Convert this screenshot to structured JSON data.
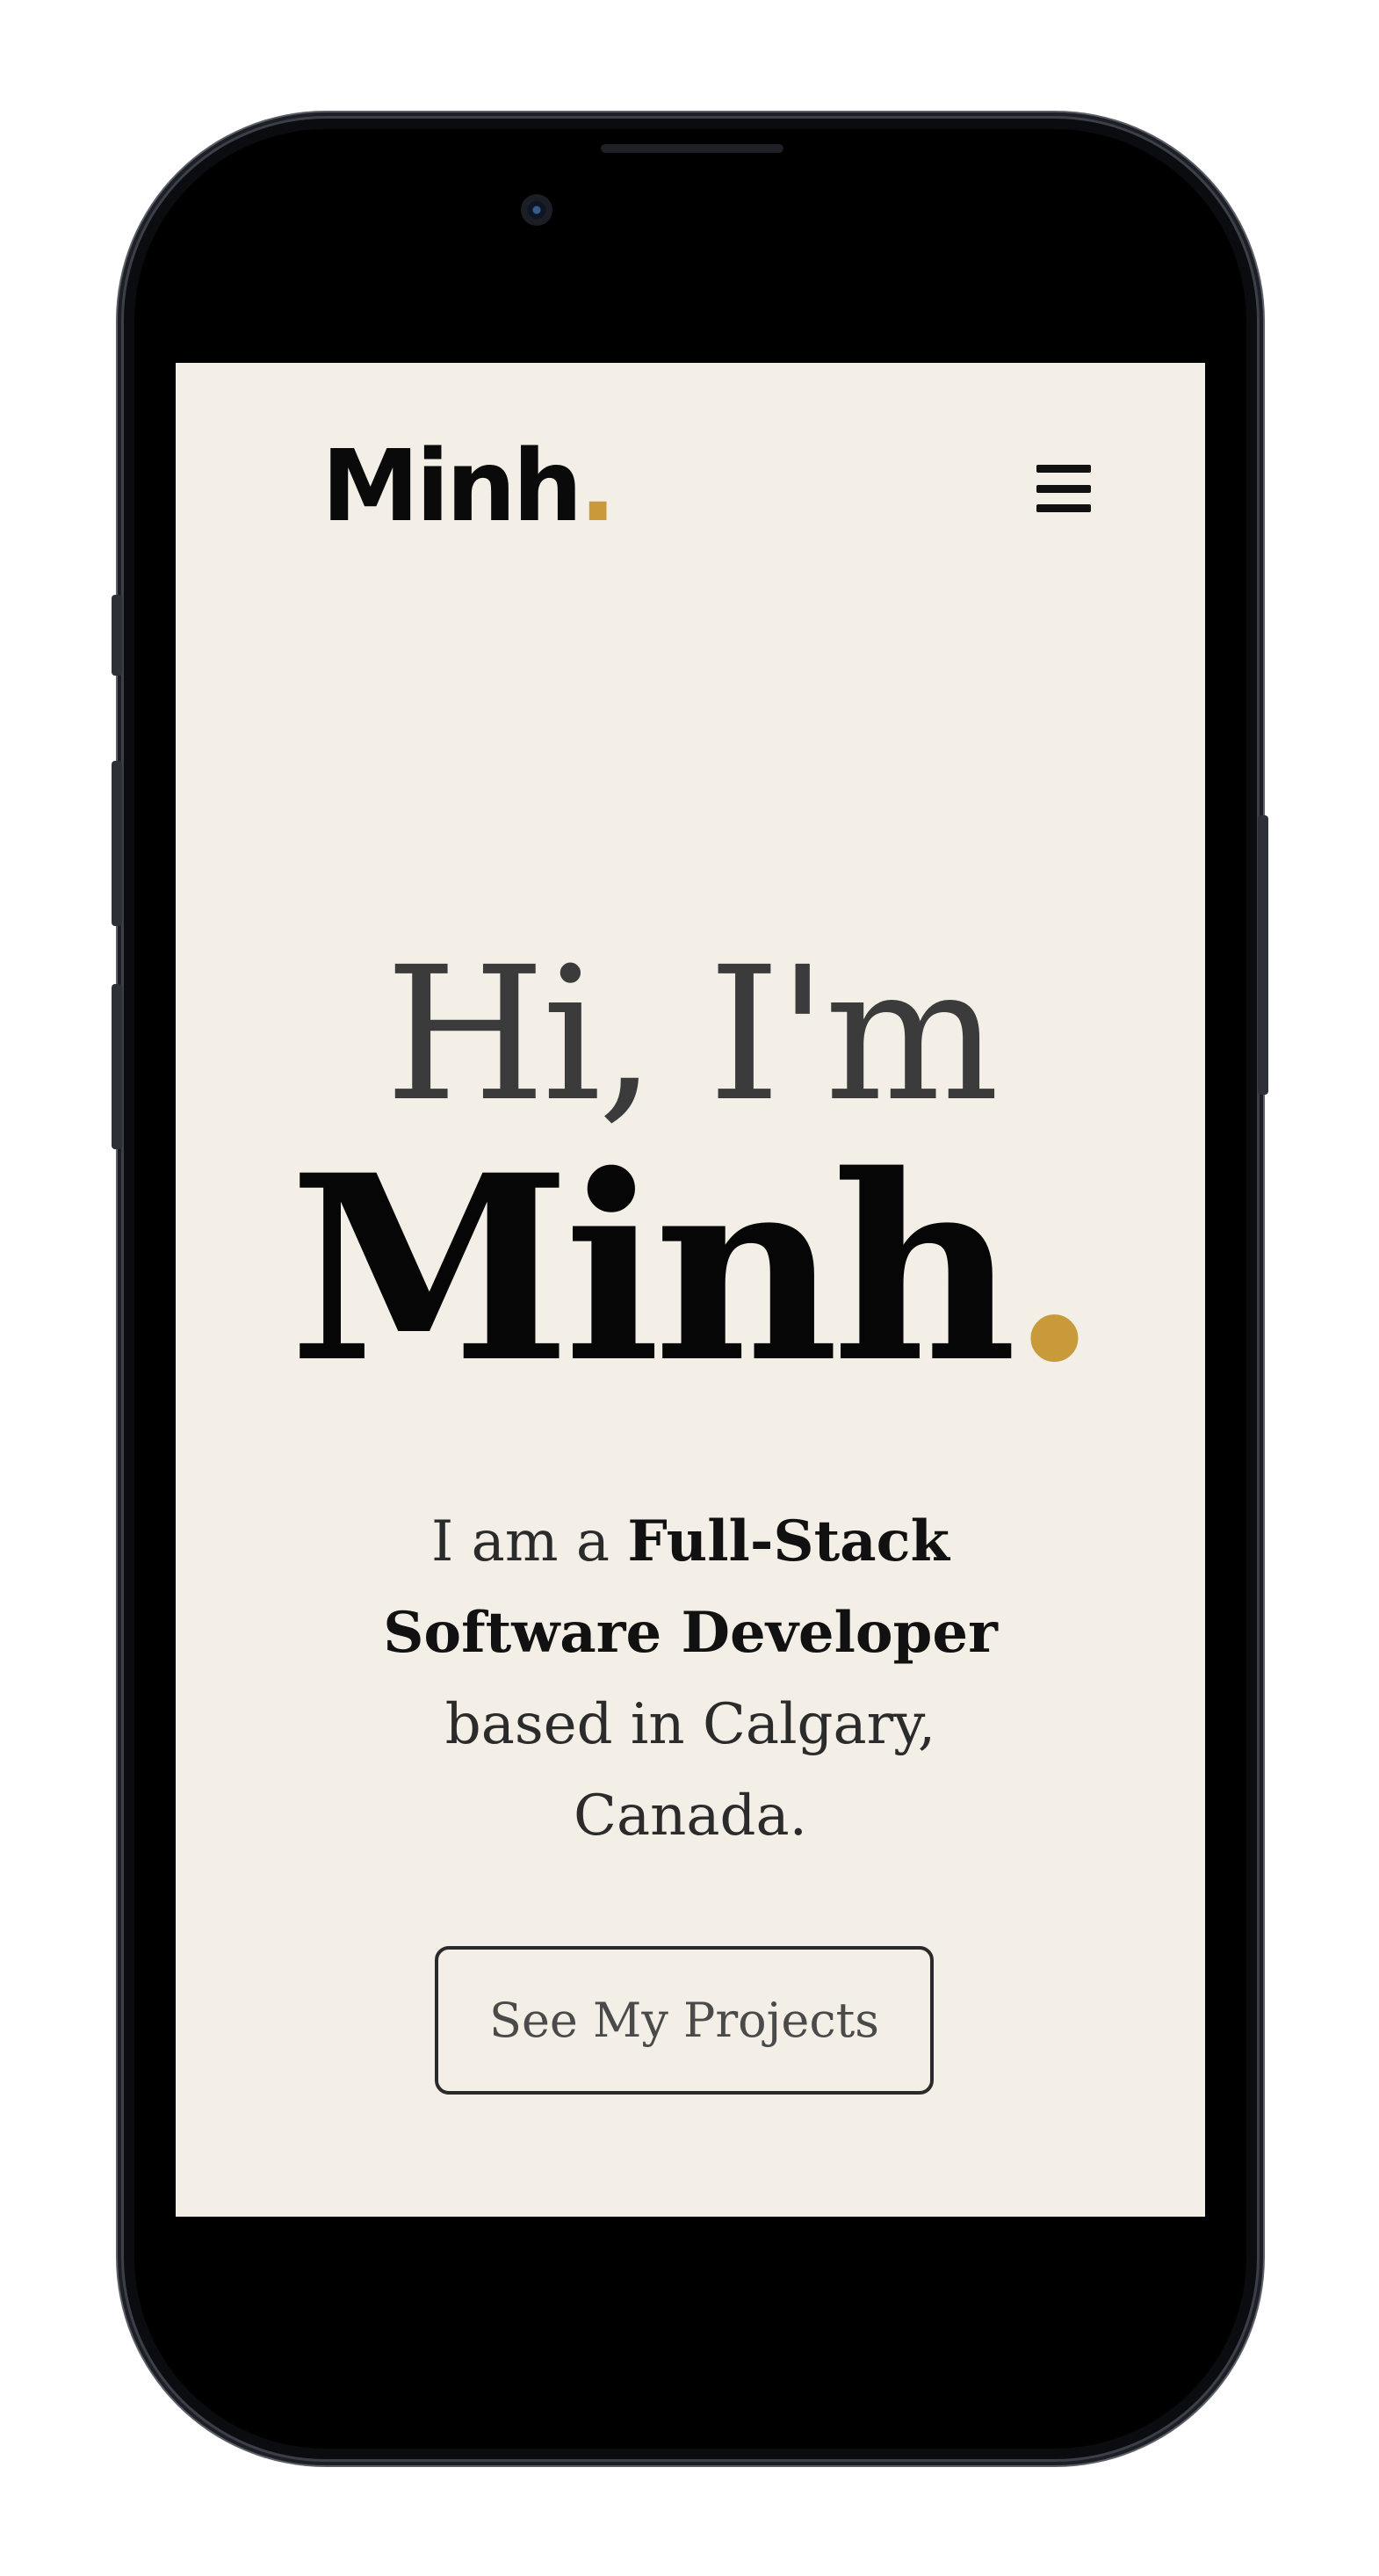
{
  "header": {
    "logo_text": "Minh",
    "logo_dot": ".",
    "menu_icon": "hamburger-icon"
  },
  "hero": {
    "greeting": "Hi, I'm",
    "name": "Minh",
    "name_dot": ".",
    "intro_prefix": "I am a ",
    "intro_role": "Full-Stack Software Developer",
    "intro_suffix": " based in Calgary, Canada.",
    "cta_label": "See My Projects"
  },
  "colors": {
    "background": "#f3efe6",
    "accent": "#c99a3a",
    "text": "#111111"
  }
}
